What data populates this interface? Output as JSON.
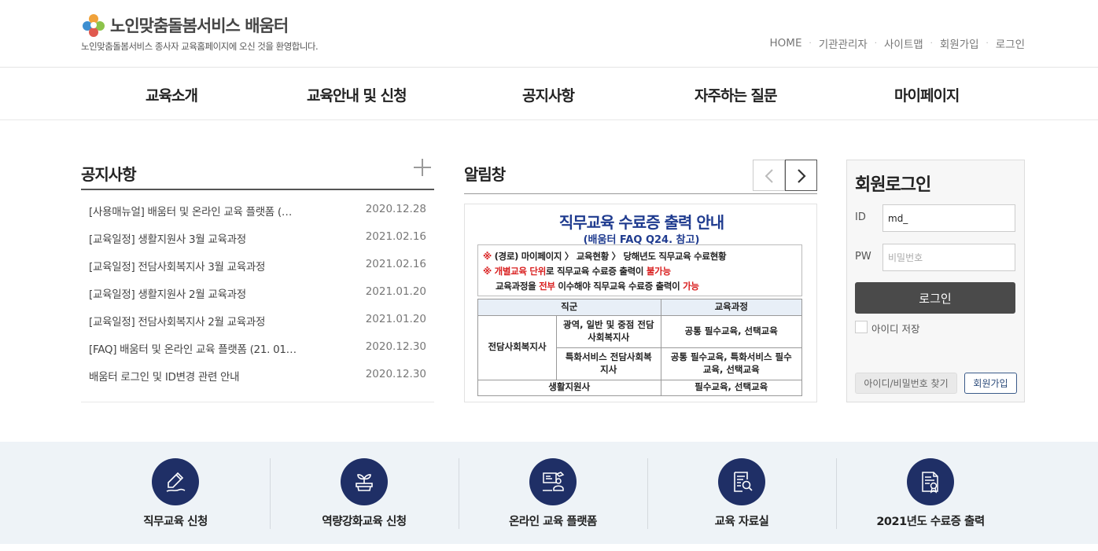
{
  "header": {
    "site_title": "노인맞춤돌봄서비스 배움터",
    "site_subtitle": "노인맞춤돌봄서비스 종사자 교육홈페이지에 오신 것을 환영합니다.",
    "util_links": [
      "HOME",
      "기관관리자",
      "사이트맵",
      "회원가입",
      "로그인"
    ]
  },
  "gnb": [
    "교육소개",
    "교육안내 및 신청",
    "공지사항",
    "자주하는 질문",
    "마이페이지"
  ],
  "notice": {
    "title": "공지사항",
    "items": [
      {
        "title": "[사용매뉴얼] 배움터 및 온라인 교육 플랫폼 (…",
        "date": "2020.12.28"
      },
      {
        "title": "[교육일정] 생활지원사 3월 교육과정",
        "date": "2021.02.16"
      },
      {
        "title": "[교육일정] 전담사회복지사 3월 교육과정",
        "date": "2021.02.16"
      },
      {
        "title": "[교육일정] 생활지원사 2월 교육과정",
        "date": "2021.01.20"
      },
      {
        "title": "[교육일정] 전담사회복지사 2월 교육과정",
        "date": "2021.01.20"
      },
      {
        "title": "[FAQ] 배움터 및 온라인 교육 플랫폼 (21. 01…",
        "date": "2020.12.30"
      },
      {
        "title": "배움터 로그인 및 ID변경 관련 안내",
        "date": "2020.12.30"
      }
    ]
  },
  "popup": {
    "title": "알림창",
    "banner": {
      "title": "직무교육 수료증 출력 안내",
      "subtitle": "(배움터 FAQ Q24. 참고)",
      "line1_mark": "※",
      "line1_text": " (경로) 마이페이지 〉 교육현황 〉 당해년도 직무교육 수료현황",
      "line2_mark": "※ ",
      "line2_red": "개별교육 단위",
      "line2_text": "로 직무교육 수료증 출력이 ",
      "line2_red2": "불가능",
      "line3_a": "교육과정을 ",
      "line3_red": "전부",
      "line3_b": " 이수해야 직무교육 수료증 출력이 ",
      "line3_red2": "가능",
      "table": {
        "head_group": "직군",
        "head_course": "교육과정",
        "group1": "전담사회복지사",
        "sub1": "광역, 일반 및 중점 전담사회복지사",
        "course1": "공통 필수교육, 선택교육",
        "sub2": "특화서비스 전담사회복지사",
        "course2": "공통 필수교육, 특화서비스 필수교육, 선택교육",
        "group2": "생활지원사",
        "course3": "필수교육, 선택교육"
      }
    }
  },
  "login": {
    "title": "회원로그인",
    "id_label": "ID",
    "id_value": "md_",
    "pw_label": "PW",
    "pw_placeholder": "비밀번호",
    "login_button": "로그인",
    "remember_label": "아이디 저장",
    "find_button": "아이디/비밀번호 찾기",
    "join_button": "회원가입"
  },
  "quick_menu": [
    "직무교육 신청",
    "역량강화교육 신청",
    "온라인 교육 플랫폼",
    "교육 자료실",
    "2021년도 수료증 출력"
  ],
  "colors": {
    "navy": "#1f2f66",
    "banner_blue": "#1f3b8f",
    "red": "#d91f1f",
    "quick_bg": "#eef3f7",
    "login_btn": "#4a4a4a"
  }
}
